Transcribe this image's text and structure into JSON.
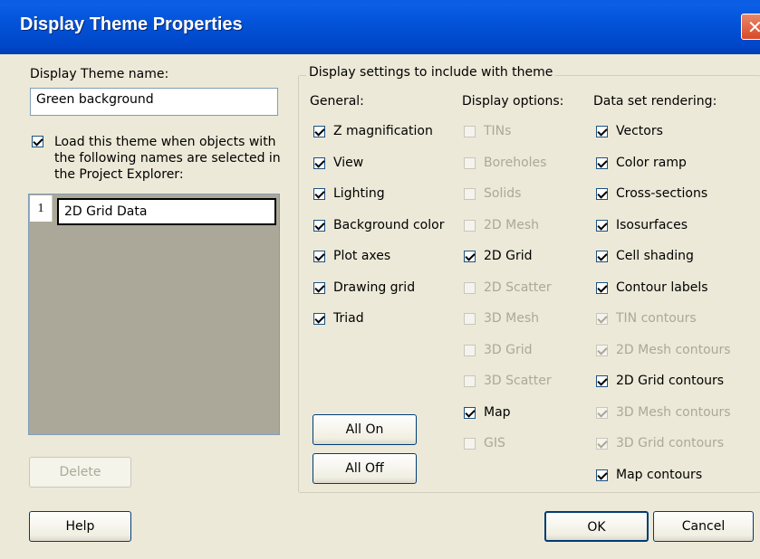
{
  "window": {
    "title": "Display Theme Properties",
    "close_glyph": "✕"
  },
  "theme_name": {
    "label": "Display Theme name:",
    "value": "Green background"
  },
  "load_theme": {
    "checked": true,
    "label_lines": [
      "Load this theme when objects with",
      "the following names are selected in",
      "the Project Explorer:"
    ]
  },
  "names_list": {
    "rows": [
      {
        "index": "1",
        "name": "2D Grid Data"
      }
    ]
  },
  "group": {
    "label": "Display settings to include with theme"
  },
  "general": {
    "header": "General:",
    "items": [
      {
        "label": "Z magnification",
        "checked": true,
        "enabled": true
      },
      {
        "label": "View",
        "checked": true,
        "enabled": true
      },
      {
        "label": "Lighting",
        "checked": true,
        "enabled": true
      },
      {
        "label": "Background color",
        "checked": true,
        "enabled": true
      },
      {
        "label": "Plot axes",
        "checked": true,
        "enabled": true
      },
      {
        "label": "Drawing grid",
        "checked": true,
        "enabled": true
      },
      {
        "label": "Triad",
        "checked": true,
        "enabled": true
      }
    ]
  },
  "display_options": {
    "header": "Display options:",
    "items": [
      {
        "label": "TINs",
        "checked": false,
        "enabled": false
      },
      {
        "label": "Boreholes",
        "checked": false,
        "enabled": false
      },
      {
        "label": "Solids",
        "checked": false,
        "enabled": false
      },
      {
        "label": "2D Mesh",
        "checked": false,
        "enabled": false
      },
      {
        "label": "2D Grid",
        "checked": true,
        "enabled": true
      },
      {
        "label": "2D Scatter",
        "checked": false,
        "enabled": false
      },
      {
        "label": "3D Mesh",
        "checked": false,
        "enabled": false
      },
      {
        "label": "3D Grid",
        "checked": false,
        "enabled": false
      },
      {
        "label": "3D Scatter",
        "checked": false,
        "enabled": false
      },
      {
        "label": "Map",
        "checked": true,
        "enabled": true
      },
      {
        "label": "GIS",
        "checked": false,
        "enabled": false
      }
    ]
  },
  "data_set_rendering": {
    "header": "Data set rendering:",
    "items": [
      {
        "label": "Vectors",
        "checked": true,
        "enabled": true
      },
      {
        "label": "Color ramp",
        "checked": true,
        "enabled": true
      },
      {
        "label": "Cross-sections",
        "checked": true,
        "enabled": true
      },
      {
        "label": "Isosurfaces",
        "checked": true,
        "enabled": true
      },
      {
        "label": "Cell shading",
        "checked": true,
        "enabled": true
      },
      {
        "label": "Contour labels",
        "checked": true,
        "enabled": true
      },
      {
        "label": "TIN contours",
        "checked": true,
        "enabled": false
      },
      {
        "label": "2D Mesh contours",
        "checked": true,
        "enabled": false
      },
      {
        "label": "2D Grid contours",
        "checked": true,
        "enabled": true
      },
      {
        "label": "3D Mesh contours",
        "checked": true,
        "enabled": false
      },
      {
        "label": "3D Grid contours",
        "checked": true,
        "enabled": false
      },
      {
        "label": "Map contours",
        "checked": true,
        "enabled": true
      }
    ]
  },
  "buttons": {
    "all_on": "All On",
    "all_off": "All Off",
    "delete": "Delete",
    "help": "Help",
    "ok": "OK",
    "cancel": "Cancel"
  },
  "colors": {
    "titlebar": "#0353d9",
    "dialog_bg": "#ece9d8",
    "check_green": "#21a121",
    "disabled_text": "#aca899"
  }
}
